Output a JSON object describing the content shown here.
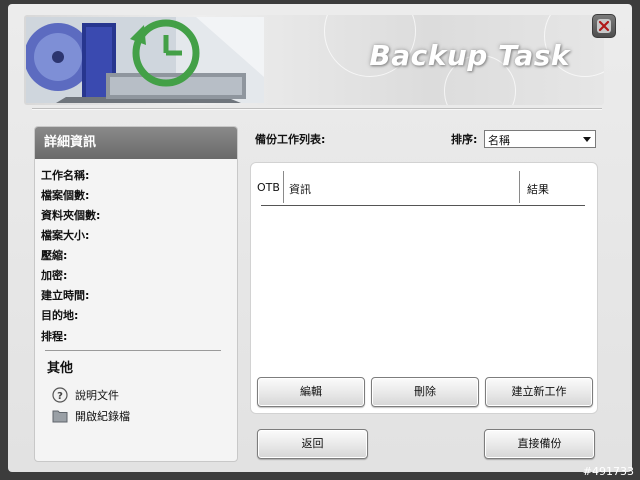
{
  "window": {
    "title": "Backup Task"
  },
  "details": {
    "header": "詳細資訊",
    "fields": [
      "工作名稱:",
      "檔案個數:",
      "資料夾個數:",
      "檔案大小:",
      "壓縮:",
      "加密:",
      "建立時間:",
      "目的地:",
      "排程:"
    ],
    "other_title": "其他",
    "help_link": "說明文件",
    "log_link": "開啟紀錄檔"
  },
  "list": {
    "title": "備份工作列表:",
    "sort_label": "排序:",
    "sort_value": "名稱",
    "columns": {
      "otb": "OTB",
      "info": "資訊",
      "result": "結果"
    }
  },
  "buttons": {
    "edit": "編輯",
    "delete": "刪除",
    "new_task": "建立新工作",
    "back": "返回",
    "backup_now": "直接備份"
  },
  "watermark": "#491733",
  "colors": {
    "header_gray": "#7a7a7a",
    "accent_green": "#4caf50"
  },
  "icons": {
    "close": "close-icon",
    "help": "help-icon",
    "folder": "folder-icon",
    "dropdown": "chevron-down-icon"
  }
}
